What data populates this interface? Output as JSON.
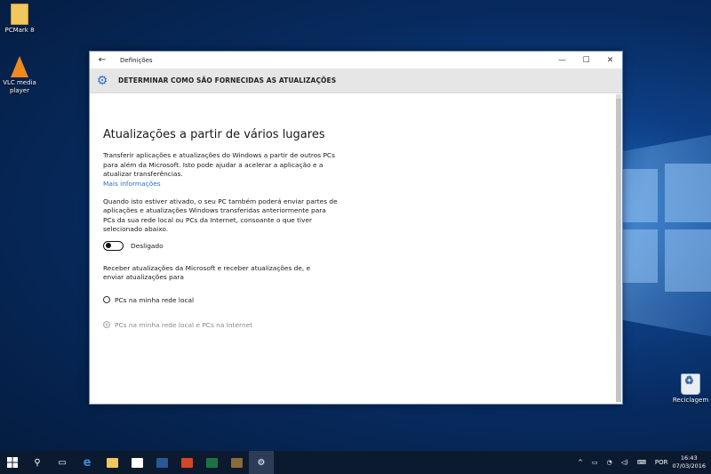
{
  "desktop": {
    "icons": [
      {
        "label": "PCMark 8"
      },
      {
        "label": "VLC media player"
      },
      {
        "label": "Reciclagem"
      }
    ]
  },
  "window": {
    "title": "Definições",
    "header_title": "DETERMINAR COMO SÃO FORNECIDAS AS ATUALIZAÇÕES",
    "section_title": "Atualizações a partir de vários lugares",
    "paragraph1": "Transferir aplicações e atualizações do Windows a partir de outros PCs para além da Microsoft. Isto pode ajudar a acelerar a aplicação e a atualizar transferências.",
    "more_info_link": "Mais informações",
    "paragraph2": "Quando isto estiver ativado, o seu PC também poderá enviar partes de aplicações e atualizações Windows transferidas anteriormente para PCs da sua rede local ou PCs da Internet, consoante o que tiver selecionado abaixo.",
    "toggle_state_label": "Desligado",
    "paragraph3": "Receber atualizações da Microsoft e receber atualizações de, e enviar atualizações para",
    "radio_options": [
      {
        "label": "PCs na minha rede local"
      },
      {
        "label": "PCs na minha rede local e PCs na Internet"
      }
    ]
  },
  "taskbar": {
    "language": "POR",
    "time": "16:43",
    "date": "07/03/2016"
  },
  "colors": {
    "accent": "#2a72c8",
    "taskbar": "#0b1a2e"
  }
}
